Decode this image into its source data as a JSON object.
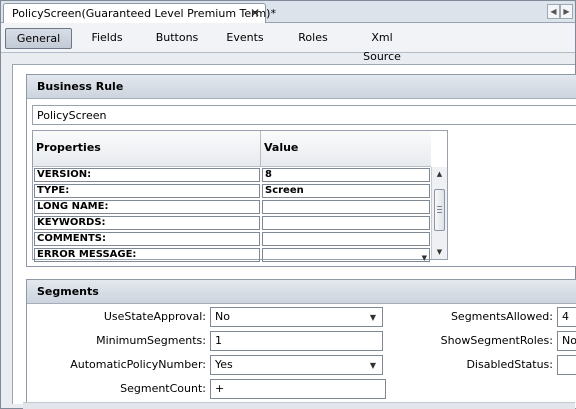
{
  "editor_tab": {
    "title": "PolicyScreen(Guaranteed Level Premium Term)*",
    "close": "✕"
  },
  "tabbar_nav": {
    "left": "◀",
    "right": "▶"
  },
  "subtabs": [
    {
      "label": "General",
      "active": true
    },
    {
      "label": "Fields"
    },
    {
      "label": "Buttons"
    },
    {
      "label": "Events"
    },
    {
      "label": "Roles"
    },
    {
      "label": "Xml Source"
    }
  ],
  "business_rule": {
    "title": "Business Rule",
    "name": "PolicyScreen",
    "grid": {
      "col_properties": "Properties",
      "col_value": "Value",
      "rows": [
        {
          "name": "VERSION:",
          "value": "8"
        },
        {
          "name": "TYPE:",
          "value": "Screen"
        },
        {
          "name": "LONG NAME:",
          "value": ""
        },
        {
          "name": "KEYWORDS:",
          "value": ""
        },
        {
          "name": "COMMENTS:",
          "value": ""
        },
        {
          "name": "ERROR MESSAGE:",
          "value": ""
        }
      ]
    },
    "scroll": {
      "up": "▲",
      "down": "▼"
    }
  },
  "segments": {
    "title": "Segments",
    "use_state_approval": {
      "label": "UseStateApproval:",
      "value": "No"
    },
    "minimum_segments": {
      "label": "MinimumSegments:",
      "value": "1"
    },
    "automatic_policy_number": {
      "label": "AutomaticPolicyNumber:",
      "value": "Yes"
    },
    "segment_count": {
      "label": "SegmentCount:",
      "value": "+"
    },
    "segments_allowed": {
      "label": "SegmentsAllowed:",
      "value": "4"
    },
    "show_segment_roles": {
      "label": "ShowSegmentRoles:",
      "value": "No"
    },
    "disabled_status": {
      "label": "DisabledStatus:",
      "value": ""
    },
    "dropdown_arrow": "▼"
  }
}
